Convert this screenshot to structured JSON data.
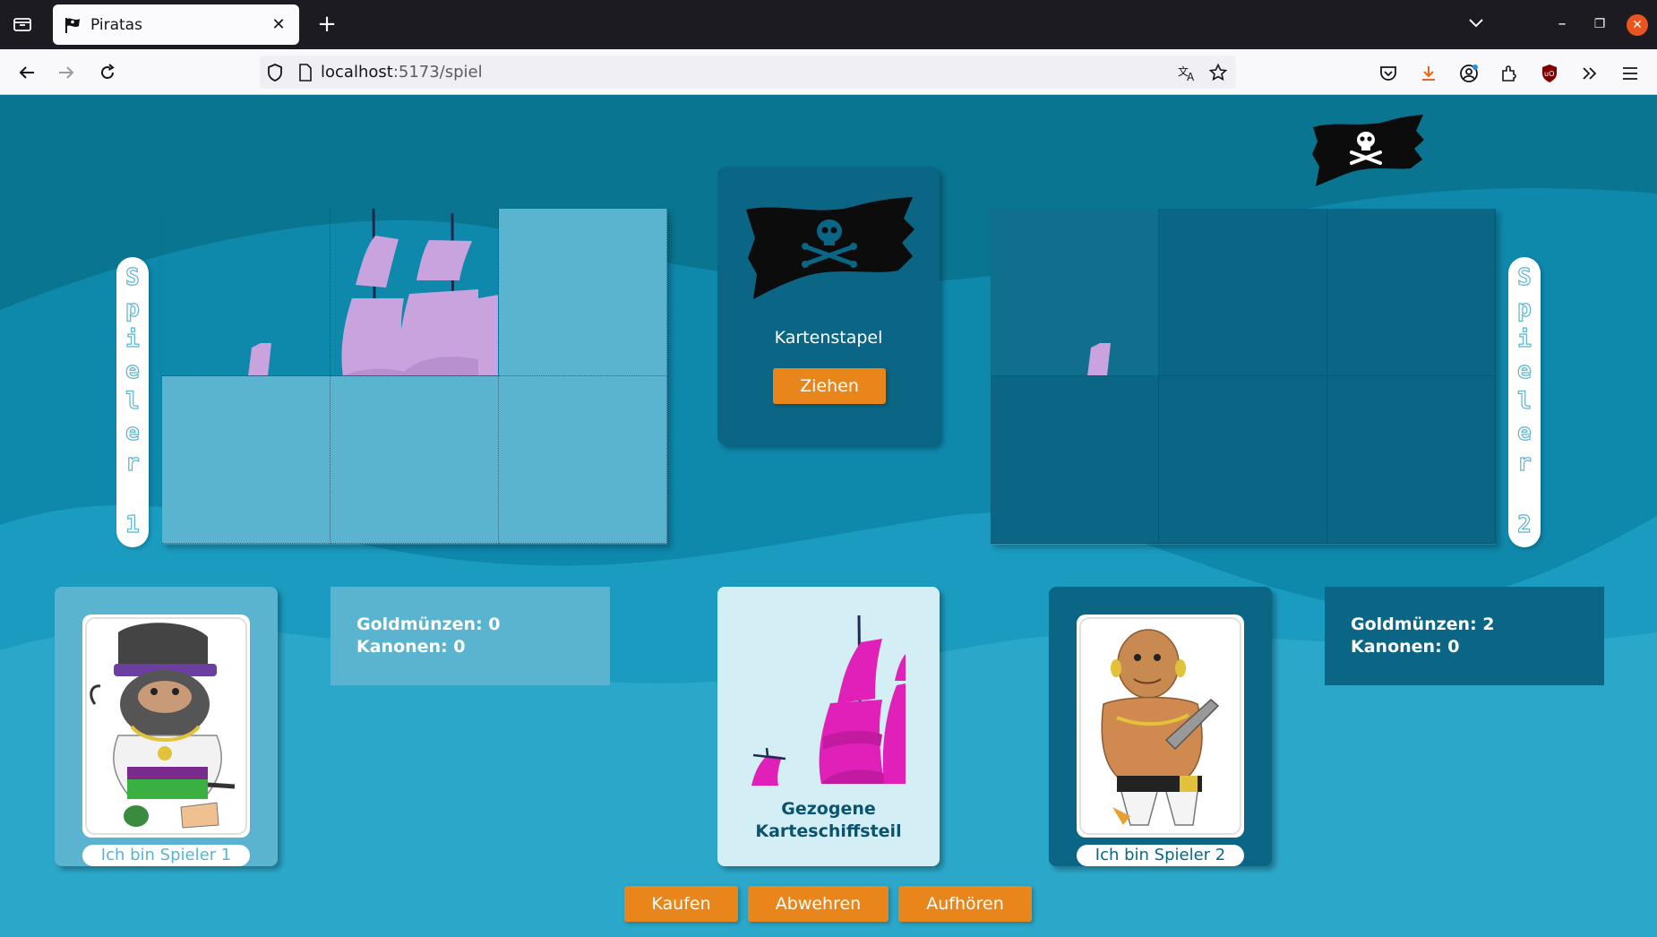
{
  "browser": {
    "tab_title": "Piratas",
    "url_host": "localhost",
    "url_path": ":5173/spiel"
  },
  "game": {
    "player1": {
      "vertical_label": [
        "S",
        "p",
        "i",
        "e",
        "l",
        "e",
        "r",
        "",
        "1"
      ],
      "name": "Ich bin Spieler 1",
      "gold_label": "Goldmünzen: 0",
      "cannons_label": "Kanonen: 0"
    },
    "player2": {
      "vertical_label": [
        "S",
        "p",
        "i",
        "e",
        "l",
        "e",
        "r",
        "",
        "2"
      ],
      "name": "Ich bin Spieler 2",
      "gold_label": "Goldmünzen: 2",
      "cannons_label": "Kanonen: 0"
    },
    "deck": {
      "title": "Kartenstapel",
      "draw_button": "Ziehen"
    },
    "drawn_card": {
      "title_line1": "Gezogene",
      "title_line2": "Karteschiffsteil"
    },
    "actions": {
      "buy": "Kaufen",
      "defend": "Abwehren",
      "stop": "Aufhören"
    }
  },
  "colors": {
    "accent_orange": "#e8861c",
    "light_panel": "#5ab4cf",
    "dark_panel": "#0b6685",
    "sail_lilac": "#c9a3dd",
    "sail_magenta": "#e020b8"
  }
}
